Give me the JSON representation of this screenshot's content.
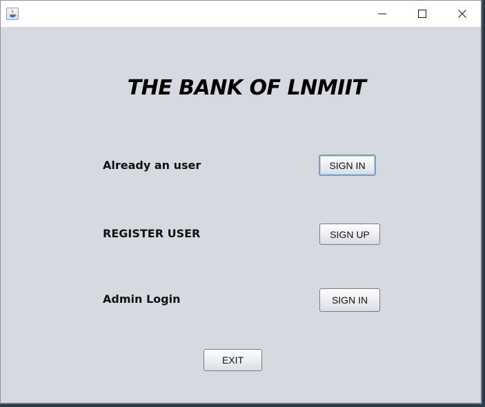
{
  "window": {
    "title": ""
  },
  "main": {
    "title": "THE BANK OF LNMIIT",
    "rows": [
      {
        "label": "Already an user",
        "button": "SIGN IN"
      },
      {
        "label": "REGISTER USER",
        "button": "SIGN UP"
      },
      {
        "label": "Admin Login",
        "button": "SIGN IN"
      }
    ],
    "exit_button": "EXIT"
  },
  "icons": {
    "app": "java-icon",
    "minimize": "minimize-icon",
    "maximize": "maximize-icon",
    "close": "close-icon"
  }
}
